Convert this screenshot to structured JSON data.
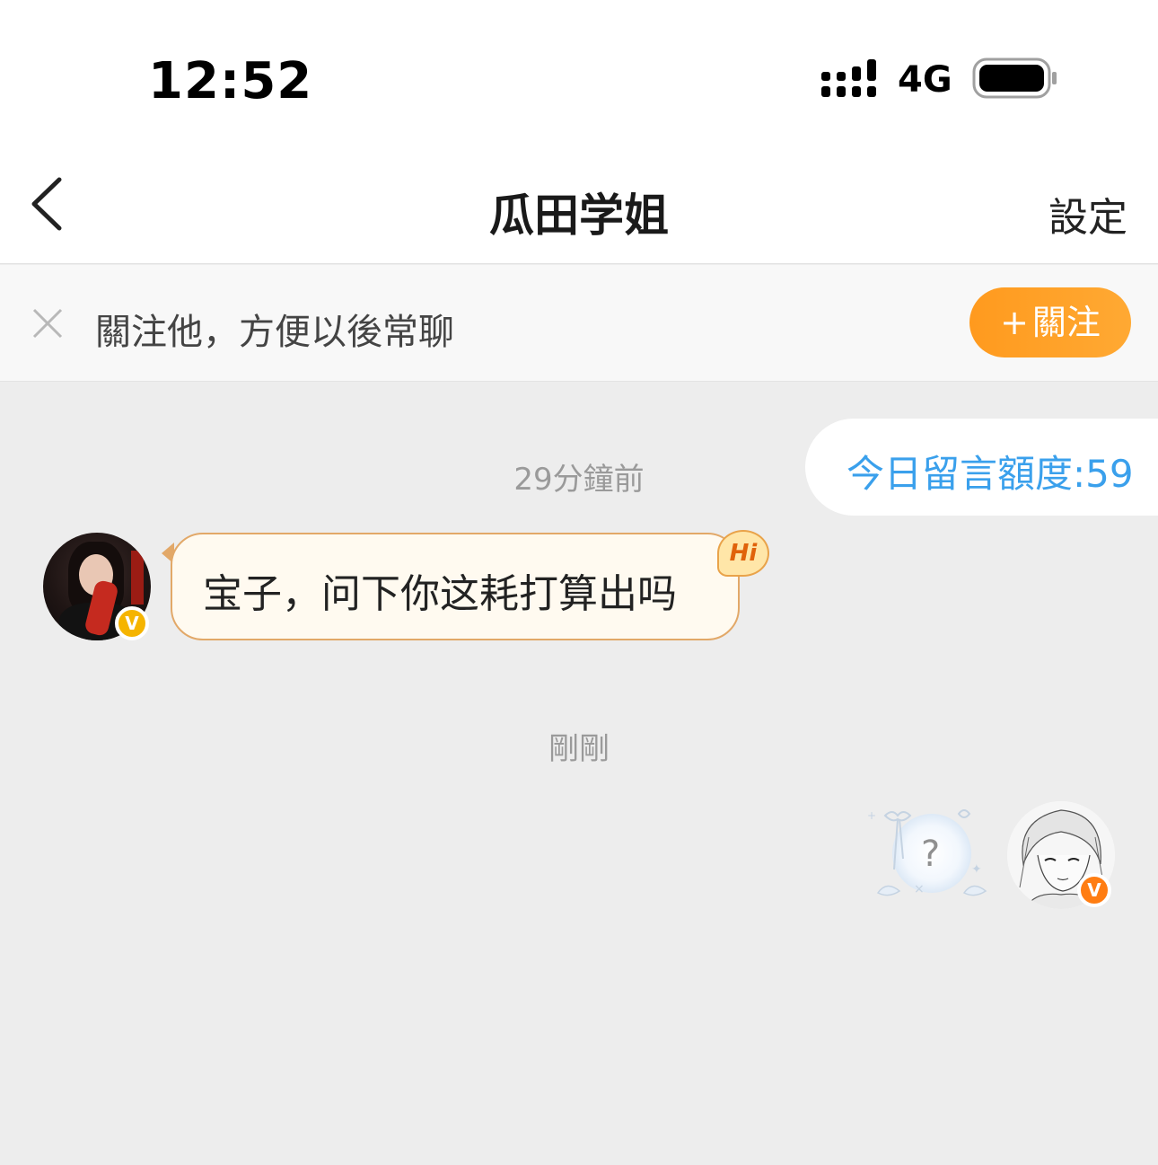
{
  "status_bar": {
    "time": "12:52",
    "network": "4G",
    "signal_icon": "signal-bars-icon",
    "battery_icon": "battery-icon"
  },
  "nav": {
    "back_icon": "chevron-left-icon",
    "title": "瓜田学姐",
    "settings_label": "設定"
  },
  "follow_banner": {
    "close_icon": "close-icon",
    "text": "關注他，方便以後常聊",
    "button_plus": "+",
    "button_label": "關注"
  },
  "quota": {
    "text": "今日留言額度:59"
  },
  "messages": [
    {
      "timestamp": "29分鐘前",
      "sender": "other",
      "text": "宝子，问下你这耗打算出吗",
      "badge": "Hi",
      "verified_badge": "V"
    },
    {
      "timestamp": "剛剛",
      "sender": "me",
      "sticker_text": "?",
      "verified_badge": "V"
    }
  ],
  "colors": {
    "accent_orange": "#ff9a1e",
    "quota_blue": "#3aa0ec",
    "chat_bg": "#ededed",
    "bubble_border": "#e2a868",
    "badge_yellow": "#f5b400",
    "badge_orange": "#ff7d12"
  }
}
